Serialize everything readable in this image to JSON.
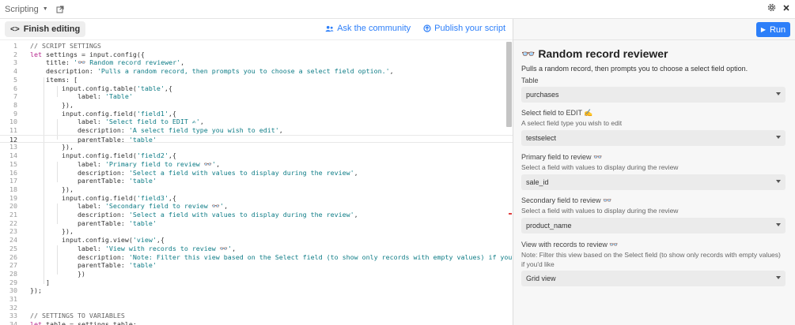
{
  "topbar": {
    "title": "Scripting"
  },
  "toolbar": {
    "finish_label": "Finish editing",
    "community_label": "Ask the community",
    "publish_label": "Publish your script"
  },
  "code_lines": [
    [
      {
        "t": "// SCRIPT SETTINGS",
        "c": "cm"
      }
    ],
    [
      {
        "t": "let",
        "c": "kw"
      },
      {
        "t": " settings = input.config({"
      }
    ],
    [
      {
        "t": "    title: "
      },
      {
        "t": "'👓 Random record reviewer'",
        "c": "str"
      },
      {
        "t": ","
      }
    ],
    [
      {
        "t": "    description: "
      },
      {
        "t": "'Pulls a random record, then prompts you to choose a select field option.'",
        "c": "str"
      },
      {
        "t": ","
      }
    ],
    [
      {
        "t": "    items: ["
      }
    ],
    [
      {
        "t": "        input.config.table("
      },
      {
        "t": "'table'",
        "c": "str"
      },
      {
        "t": ",{"
      }
    ],
    [
      {
        "t": "            label: "
      },
      {
        "t": "'Table'",
        "c": "str"
      }
    ],
    [
      {
        "t": "        }),"
      }
    ],
    [
      {
        "t": "        input.config.field("
      },
      {
        "t": "'field1'",
        "c": "str"
      },
      {
        "t": ",{"
      }
    ],
    [
      {
        "t": "            label: "
      },
      {
        "t": "'Select field to EDIT ✍'",
        "c": "str"
      },
      {
        "t": ","
      }
    ],
    [
      {
        "t": "            description: "
      },
      {
        "t": "'A select field type you wish to edit'",
        "c": "str"
      },
      {
        "t": ","
      }
    ],
    [
      {
        "t": "            parentTable: "
      },
      {
        "t": "'table'",
        "c": "str"
      }
    ],
    [
      {
        "t": "        }),"
      }
    ],
    [
      {
        "t": "        input.config.field("
      },
      {
        "t": "'field2'",
        "c": "str"
      },
      {
        "t": ",{"
      }
    ],
    [
      {
        "t": "            label: "
      },
      {
        "t": "'Primary field to review 👓'",
        "c": "str"
      },
      {
        "t": ","
      }
    ],
    [
      {
        "t": "            description: "
      },
      {
        "t": "'Select a field with values to display during the review'",
        "c": "str"
      },
      {
        "t": ","
      }
    ],
    [
      {
        "t": "            parentTable: "
      },
      {
        "t": "'table'",
        "c": "str"
      }
    ],
    [
      {
        "t": "        }),"
      }
    ],
    [
      {
        "t": "        input.config.field("
      },
      {
        "t": "'field3'",
        "c": "str"
      },
      {
        "t": ",{"
      }
    ],
    [
      {
        "t": "            label: "
      },
      {
        "t": "'Secondary field to review 👓'",
        "c": "str"
      },
      {
        "t": ","
      }
    ],
    [
      {
        "t": "            description: "
      },
      {
        "t": "'Select a field with values to display during the review'",
        "c": "str"
      },
      {
        "t": ","
      }
    ],
    [
      {
        "t": "            parentTable: "
      },
      {
        "t": "'table'",
        "c": "str"
      }
    ],
    [
      {
        "t": "        }),"
      }
    ],
    [
      {
        "t": "        input.config.view("
      },
      {
        "t": "'view'",
        "c": "str"
      },
      {
        "t": ",{"
      }
    ],
    [
      {
        "t": "            label: "
      },
      {
        "t": "'View with records to review 👓'",
        "c": "str"
      },
      {
        "t": ","
      }
    ],
    [
      {
        "t": "            description: "
      },
      {
        "t": "'Note: Filter this view based on the Select field (to show only records with empty values) if you\\'d like'",
        "c": "str"
      },
      {
        "t": ","
      }
    ],
    [
      {
        "t": "            parentTable: "
      },
      {
        "t": "'table'",
        "c": "str"
      }
    ],
    [
      {
        "t": "            })"
      }
    ],
    [
      {
        "t": "    ]"
      }
    ],
    [
      {
        "t": "});"
      }
    ],
    [],
    [],
    [
      {
        "t": "// SETTINGS TO VARIABLES",
        "c": "cm"
      }
    ],
    [
      {
        "t": "let",
        "c": "kw"
      },
      {
        "t": " table = settings.table;"
      }
    ]
  ],
  "active_line": 12,
  "panel": {
    "run_label": "Run",
    "title": "👓 Random record reviewer",
    "description": "Pulls a random record, then prompts you to choose a select field option.",
    "fields": [
      {
        "label": "Table",
        "help": "",
        "value": "purchases"
      },
      {
        "label": "Select field to EDIT ✍",
        "help": "A select field type you wish to edit",
        "value": "testselect"
      },
      {
        "label": "Primary field to review 👓",
        "help": "Select a field with values to display during the review",
        "value": "sale_id"
      },
      {
        "label": "Secondary field to review 👓",
        "help": "Select a field with values to display during the review",
        "value": "product_name"
      },
      {
        "label": "View with records to review 👓",
        "help": "Note: Filter this view based on the Select field (to show only records with empty values) if you'd like",
        "value": "Grid view"
      }
    ]
  },
  "colors": {
    "accent": "#2d7ff9",
    "keyword": "#b5258c",
    "string": "#0e7c86"
  }
}
